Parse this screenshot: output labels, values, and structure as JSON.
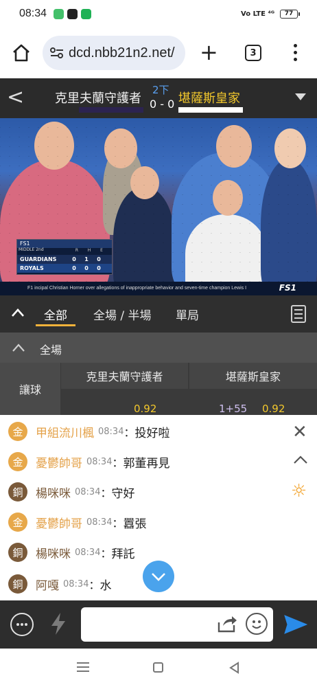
{
  "status_bar": {
    "time": "08:34",
    "network": "Vo LTE ⁴ᴳ",
    "battery": "77",
    "colors": {
      "app1": "#43c06a",
      "app2": "#222222",
      "app3": "#1fb155"
    }
  },
  "browser": {
    "url": "dcd.nbb21n2.net/",
    "tab_count": "3",
    "icons": [
      "home-icon",
      "site-settings-icon",
      "new-tab-icon",
      "tabs-icon",
      "menu-icon"
    ]
  },
  "game": {
    "home_team": "克里夫蘭守護者",
    "away_team": "堪薩斯皇家",
    "inning": "2下",
    "score": "0 - 0",
    "colors": {
      "away": "#f3c82c",
      "inning": "#5aa0f0"
    }
  },
  "video": {
    "scorebug": {
      "network": "FS1",
      "inning": "MIDDLE 2nd",
      "headers": [
        "R",
        "H",
        "E"
      ],
      "teams": [
        {
          "name": "GUARDIANS",
          "r": "0",
          "h": "1",
          "e": "0"
        },
        {
          "name": "ROYALS",
          "r": "0",
          "h": "0",
          "e": "0"
        }
      ]
    },
    "ticker": "F1   incipal Christian Horner over allegations of inappropriate behavior and seven-time champion Lewis I",
    "logo": "FS1"
  },
  "bet_tabs": {
    "tabs": [
      "全部",
      "全場 / 半場",
      "單局"
    ],
    "active": "全部"
  },
  "odds": {
    "section": "全場",
    "columns": [
      "克里夫蘭守護者",
      "堪薩斯皇家"
    ],
    "row_label": "讓球",
    "home_odds": "0.92",
    "away_handicap": "1+55",
    "away_odds": "0.92"
  },
  "chat": {
    "messages": [
      {
        "badge": "金",
        "tier": "gold",
        "user": "甲組流川楓",
        "time": "08:34",
        "text": "投好啦"
      },
      {
        "badge": "金",
        "tier": "gold",
        "user": "憂鬱帥哥",
        "time": "08:34",
        "text": "郭董再見"
      },
      {
        "badge": "銅",
        "tier": "bronze",
        "user": "楊咪咪",
        "time": "08:34",
        "text": "守好"
      },
      {
        "badge": "金",
        "tier": "gold",
        "user": "憂鬱帥哥",
        "time": "08:34",
        "text": "囂張"
      },
      {
        "badge": "銅",
        "tier": "bronze",
        "user": "楊咪咪",
        "time": "08:34",
        "text": "拜託"
      },
      {
        "badge": "銅",
        "tier": "bronze",
        "user": "阿嘎",
        "time": "08:34",
        "text": "水"
      }
    ],
    "colon": "：",
    "colors": {
      "gold": "#e4a24a",
      "bronze": "#7a5a3a",
      "scroll_button": "#4aa3ec",
      "send": "#2a8be8"
    }
  },
  "input": {
    "placeholder": ""
  }
}
